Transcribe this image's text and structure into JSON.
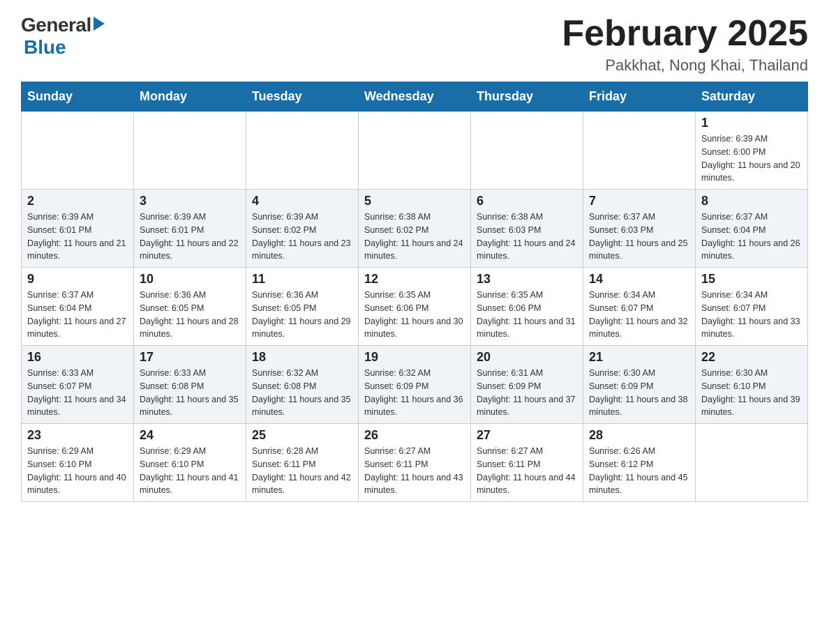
{
  "logo": {
    "general": "General",
    "arrow": "▶",
    "blue": "Blue"
  },
  "title": "February 2025",
  "location": "Pakkhat, Nong Khai, Thailand",
  "days_of_week": [
    "Sunday",
    "Monday",
    "Tuesday",
    "Wednesday",
    "Thursday",
    "Friday",
    "Saturday"
  ],
  "weeks": [
    [
      {
        "day": "",
        "info": ""
      },
      {
        "day": "",
        "info": ""
      },
      {
        "day": "",
        "info": ""
      },
      {
        "day": "",
        "info": ""
      },
      {
        "day": "",
        "info": ""
      },
      {
        "day": "",
        "info": ""
      },
      {
        "day": "1",
        "info": "Sunrise: 6:39 AM\nSunset: 6:00 PM\nDaylight: 11 hours and 20 minutes."
      }
    ],
    [
      {
        "day": "2",
        "info": "Sunrise: 6:39 AM\nSunset: 6:01 PM\nDaylight: 11 hours and 21 minutes."
      },
      {
        "day": "3",
        "info": "Sunrise: 6:39 AM\nSunset: 6:01 PM\nDaylight: 11 hours and 22 minutes."
      },
      {
        "day": "4",
        "info": "Sunrise: 6:39 AM\nSunset: 6:02 PM\nDaylight: 11 hours and 23 minutes."
      },
      {
        "day": "5",
        "info": "Sunrise: 6:38 AM\nSunset: 6:02 PM\nDaylight: 11 hours and 24 minutes."
      },
      {
        "day": "6",
        "info": "Sunrise: 6:38 AM\nSunset: 6:03 PM\nDaylight: 11 hours and 24 minutes."
      },
      {
        "day": "7",
        "info": "Sunrise: 6:37 AM\nSunset: 6:03 PM\nDaylight: 11 hours and 25 minutes."
      },
      {
        "day": "8",
        "info": "Sunrise: 6:37 AM\nSunset: 6:04 PM\nDaylight: 11 hours and 26 minutes."
      }
    ],
    [
      {
        "day": "9",
        "info": "Sunrise: 6:37 AM\nSunset: 6:04 PM\nDaylight: 11 hours and 27 minutes."
      },
      {
        "day": "10",
        "info": "Sunrise: 6:36 AM\nSunset: 6:05 PM\nDaylight: 11 hours and 28 minutes."
      },
      {
        "day": "11",
        "info": "Sunrise: 6:36 AM\nSunset: 6:05 PM\nDaylight: 11 hours and 29 minutes."
      },
      {
        "day": "12",
        "info": "Sunrise: 6:35 AM\nSunset: 6:06 PM\nDaylight: 11 hours and 30 minutes."
      },
      {
        "day": "13",
        "info": "Sunrise: 6:35 AM\nSunset: 6:06 PM\nDaylight: 11 hours and 31 minutes."
      },
      {
        "day": "14",
        "info": "Sunrise: 6:34 AM\nSunset: 6:07 PM\nDaylight: 11 hours and 32 minutes."
      },
      {
        "day": "15",
        "info": "Sunrise: 6:34 AM\nSunset: 6:07 PM\nDaylight: 11 hours and 33 minutes."
      }
    ],
    [
      {
        "day": "16",
        "info": "Sunrise: 6:33 AM\nSunset: 6:07 PM\nDaylight: 11 hours and 34 minutes."
      },
      {
        "day": "17",
        "info": "Sunrise: 6:33 AM\nSunset: 6:08 PM\nDaylight: 11 hours and 35 minutes."
      },
      {
        "day": "18",
        "info": "Sunrise: 6:32 AM\nSunset: 6:08 PM\nDaylight: 11 hours and 35 minutes."
      },
      {
        "day": "19",
        "info": "Sunrise: 6:32 AM\nSunset: 6:09 PM\nDaylight: 11 hours and 36 minutes."
      },
      {
        "day": "20",
        "info": "Sunrise: 6:31 AM\nSunset: 6:09 PM\nDaylight: 11 hours and 37 minutes."
      },
      {
        "day": "21",
        "info": "Sunrise: 6:30 AM\nSunset: 6:09 PM\nDaylight: 11 hours and 38 minutes."
      },
      {
        "day": "22",
        "info": "Sunrise: 6:30 AM\nSunset: 6:10 PM\nDaylight: 11 hours and 39 minutes."
      }
    ],
    [
      {
        "day": "23",
        "info": "Sunrise: 6:29 AM\nSunset: 6:10 PM\nDaylight: 11 hours and 40 minutes."
      },
      {
        "day": "24",
        "info": "Sunrise: 6:29 AM\nSunset: 6:10 PM\nDaylight: 11 hours and 41 minutes."
      },
      {
        "day": "25",
        "info": "Sunrise: 6:28 AM\nSunset: 6:11 PM\nDaylight: 11 hours and 42 minutes."
      },
      {
        "day": "26",
        "info": "Sunrise: 6:27 AM\nSunset: 6:11 PM\nDaylight: 11 hours and 43 minutes."
      },
      {
        "day": "27",
        "info": "Sunrise: 6:27 AM\nSunset: 6:11 PM\nDaylight: 11 hours and 44 minutes."
      },
      {
        "day": "28",
        "info": "Sunrise: 6:26 AM\nSunset: 6:12 PM\nDaylight: 11 hours and 45 minutes."
      },
      {
        "day": "",
        "info": ""
      }
    ]
  ]
}
